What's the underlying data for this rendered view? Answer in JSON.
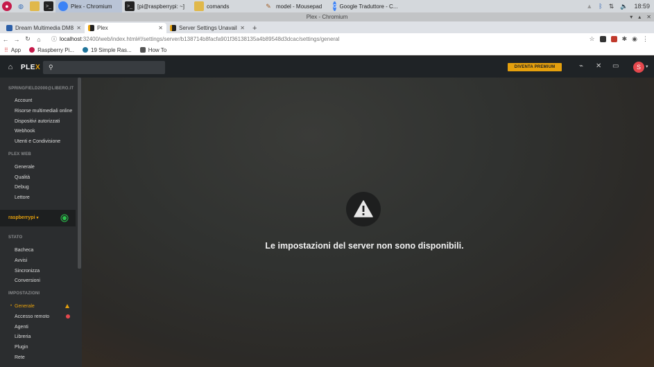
{
  "taskbar": {
    "tasks": [
      {
        "label": "Plex - Chromium"
      },
      {
        "label": "[pi@raspberrypi: ~]"
      },
      {
        "label": "comands"
      },
      {
        "label": "model - Mousepad"
      },
      {
        "label": "Google Traduttore - C..."
      }
    ],
    "clock": "18:59"
  },
  "window": {
    "title": "Plex - Chromium"
  },
  "tabs": [
    {
      "label": "Dream Multimedia DM8"
    },
    {
      "label": "Plex"
    },
    {
      "label": "Server Settings Unavaila"
    }
  ],
  "address": {
    "host": "localhost",
    "path": ":32400/web/index.html#!/settings/server/b138714b8facfa901f36138135a4b89548d3dcac/settings/general"
  },
  "bookmarks": [
    {
      "label": "App"
    },
    {
      "label": "Raspberry Pi..."
    },
    {
      "label": "19 Simple Ras..."
    },
    {
      "label": "How To"
    }
  ],
  "plex": {
    "logo_main": "PLE",
    "logo_x": "X",
    "premium_label": "DIVENTA PREMIUM",
    "avatar_letter": "S"
  },
  "sidebar": {
    "account_header": "SPRINGFIELD2000@LIBERO.IT",
    "account_items": [
      "Account",
      "Risorse multimediali online",
      "Dispositivi autorizzati",
      "Webhook",
      "Utenti e Condivisione"
    ],
    "web_header": "PLEX WEB",
    "web_items": [
      "Generale",
      "Qualità",
      "Debug",
      "Lettore"
    ],
    "server_name": "raspberrypi",
    "status_header": "STATO",
    "status_items": [
      "Bacheca",
      "Avvisi",
      "Sincronizza",
      "Conversioni"
    ],
    "settings_header": "IMPOSTAZIONI",
    "settings_items": [
      "Generale",
      "Accesso remoto",
      "Agenti",
      "Libreria",
      "Plugin",
      "Rete"
    ]
  },
  "main": {
    "message": "Le impostazioni del server non sono disponibili."
  },
  "colors": {
    "accent": "#e5a00d",
    "status_ok": "#2bbf4b",
    "error": "#e5484d"
  }
}
